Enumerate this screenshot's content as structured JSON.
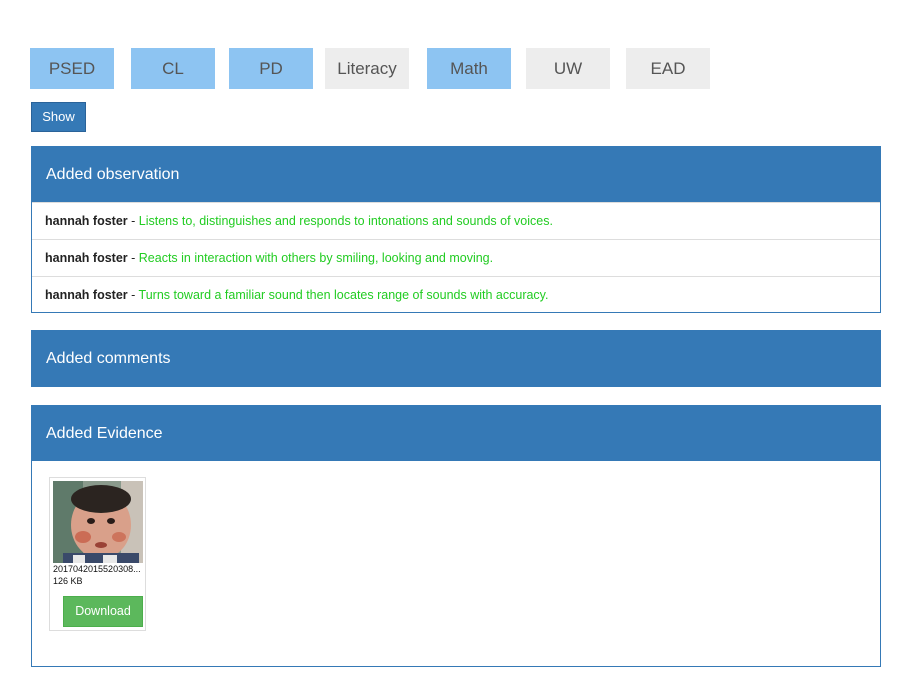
{
  "tabs": [
    {
      "label": "PSED",
      "active": true
    },
    {
      "label": "CL",
      "active": true
    },
    {
      "label": "PD",
      "active": true
    },
    {
      "label": "Literacy",
      "active": false
    },
    {
      "label": "Math",
      "active": true
    },
    {
      "label": "UW",
      "active": false
    },
    {
      "label": "EAD",
      "active": false
    }
  ],
  "show_button": "Show",
  "observations_panel": {
    "title": "Added observation",
    "items": [
      {
        "name": "hannah foster",
        "separator": " - ",
        "text": "Listens to, distinguishes and responds to intonations and sounds of voices."
      },
      {
        "name": "hannah foster",
        "separator": " - ",
        "text": "Reacts in interaction with others by smiling, looking and moving."
      },
      {
        "name": "hannah foster",
        "separator": " - ",
        "text": "Turns toward a familiar sound then locates range of sounds with accuracy."
      }
    ]
  },
  "comments_panel": {
    "title": "Added comments"
  },
  "evidence_panel": {
    "title": "Added Evidence",
    "file": {
      "name": "2017042015520308...",
      "size": "126 KB",
      "download_label": "Download"
    }
  },
  "colors": {
    "primary": "#3579b6",
    "tab_active": "#8dc4f2",
    "tab_inactive": "#ededed",
    "observation_text": "#22cc22",
    "download": "#5cb85c"
  }
}
